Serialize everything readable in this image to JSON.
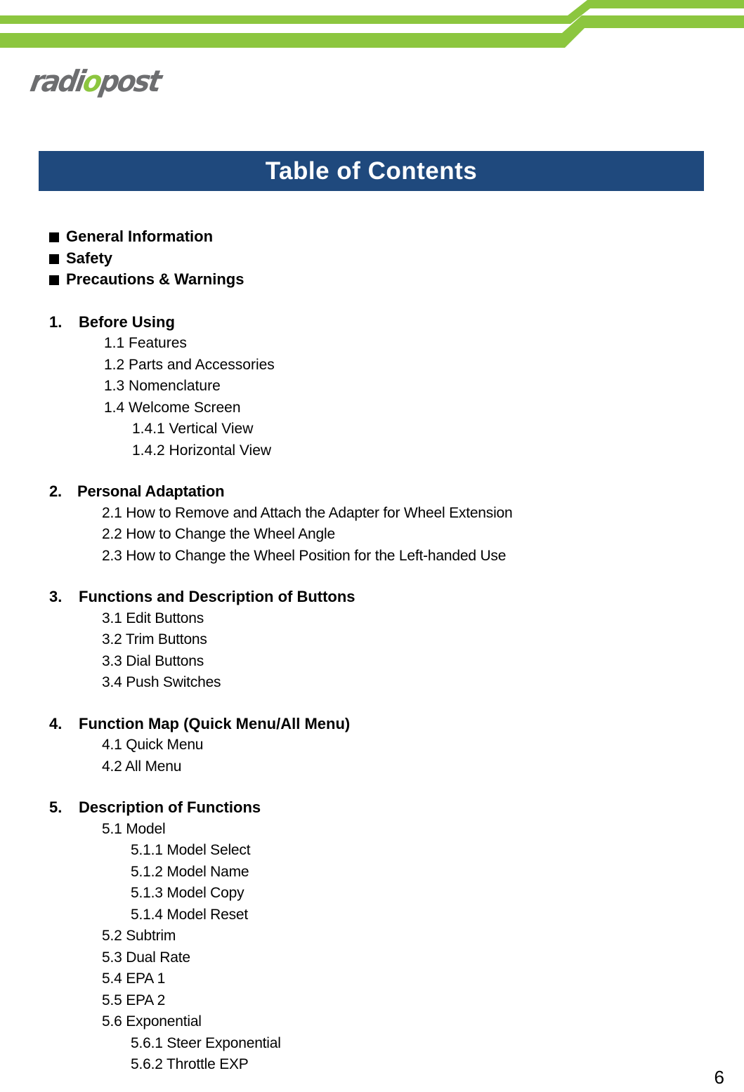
{
  "colors": {
    "banner_green": "#8cc63f",
    "title_bar_blue": "#1f497d",
    "logo_gray": "#6d6e70",
    "text_black": "#000000"
  },
  "logo": {
    "name": "radiopost",
    "part_before": "radi",
    "part_accent": "o",
    "part_after": "post"
  },
  "header": {
    "title": "Table of Contents"
  },
  "bullets": [
    {
      "marker": "■",
      "label": "General Information"
    },
    {
      "marker": "■",
      "label": "Safety"
    },
    {
      "marker": "■",
      "label": "Precautions & Warnings"
    }
  ],
  "sections": [
    {
      "number": "1.",
      "title": "Before Using",
      "items": [
        {
          "level": 2,
          "text": "1.1 Features"
        },
        {
          "level": 2,
          "text": "1.2 Parts and Accessories"
        },
        {
          "level": 2,
          "text": "1.3 Nomenclature"
        },
        {
          "level": 2,
          "text": "1.4 Welcome Screen"
        },
        {
          "level": 3,
          "text": "1.4.1 Vertical View"
        },
        {
          "level": 3,
          "text": "1.4.2 Horizontal View"
        }
      ]
    },
    {
      "number": "2.",
      "title": "Personal Adaptation",
      "items": [
        {
          "level": 2,
          "text": "2.1 How to Remove and Attach the Adapter for Wheel Extension"
        },
        {
          "level": 2,
          "text": "2.2 How to Change the Wheel Angle"
        },
        {
          "level": 2,
          "text": "2.3 How to Change the Wheel Position for the Left-handed Use"
        }
      ]
    },
    {
      "number": "3.",
      "title": "Functions and Description of Buttons",
      "items": [
        {
          "level": 2,
          "text": "3.1 Edit Buttons"
        },
        {
          "level": 2,
          "text": "3.2 Trim Buttons"
        },
        {
          "level": 2,
          "text": "3.3 Dial Buttons"
        },
        {
          "level": 2,
          "text": "3.4 Push Switches"
        }
      ]
    },
    {
      "number": "4.",
      "title": "Function Map (Quick Menu/All Menu)",
      "items": [
        {
          "level": 2,
          "text": "4.1 Quick Menu"
        },
        {
          "level": 2,
          "text": "4.2 All Menu"
        }
      ]
    },
    {
      "number": "5.",
      "title": "Description of Functions",
      "items": [
        {
          "level": 2,
          "text": "5.1 Model"
        },
        {
          "level": 3,
          "text": "5.1.1 Model Select"
        },
        {
          "level": 3,
          "text": "5.1.2 Model Name"
        },
        {
          "level": 3,
          "text": "5.1.3 Model Copy"
        },
        {
          "level": 3,
          "text": "5.1.4 Model Reset"
        },
        {
          "level": 2,
          "text": "5.2 Subtrim"
        },
        {
          "level": 2,
          "text": "5.3 Dual Rate"
        },
        {
          "level": 2,
          "text": "5.4 EPA 1"
        },
        {
          "level": 2,
          "text": "5.5 EPA 2"
        },
        {
          "level": 2,
          "text": "5.6 Exponential"
        },
        {
          "level": 3,
          "text": "5.6.1 Steer Exponential"
        },
        {
          "level": 3,
          "text": "5.6.2 Throttle EXP"
        }
      ]
    }
  ],
  "footer": {
    "page_number": "6"
  }
}
